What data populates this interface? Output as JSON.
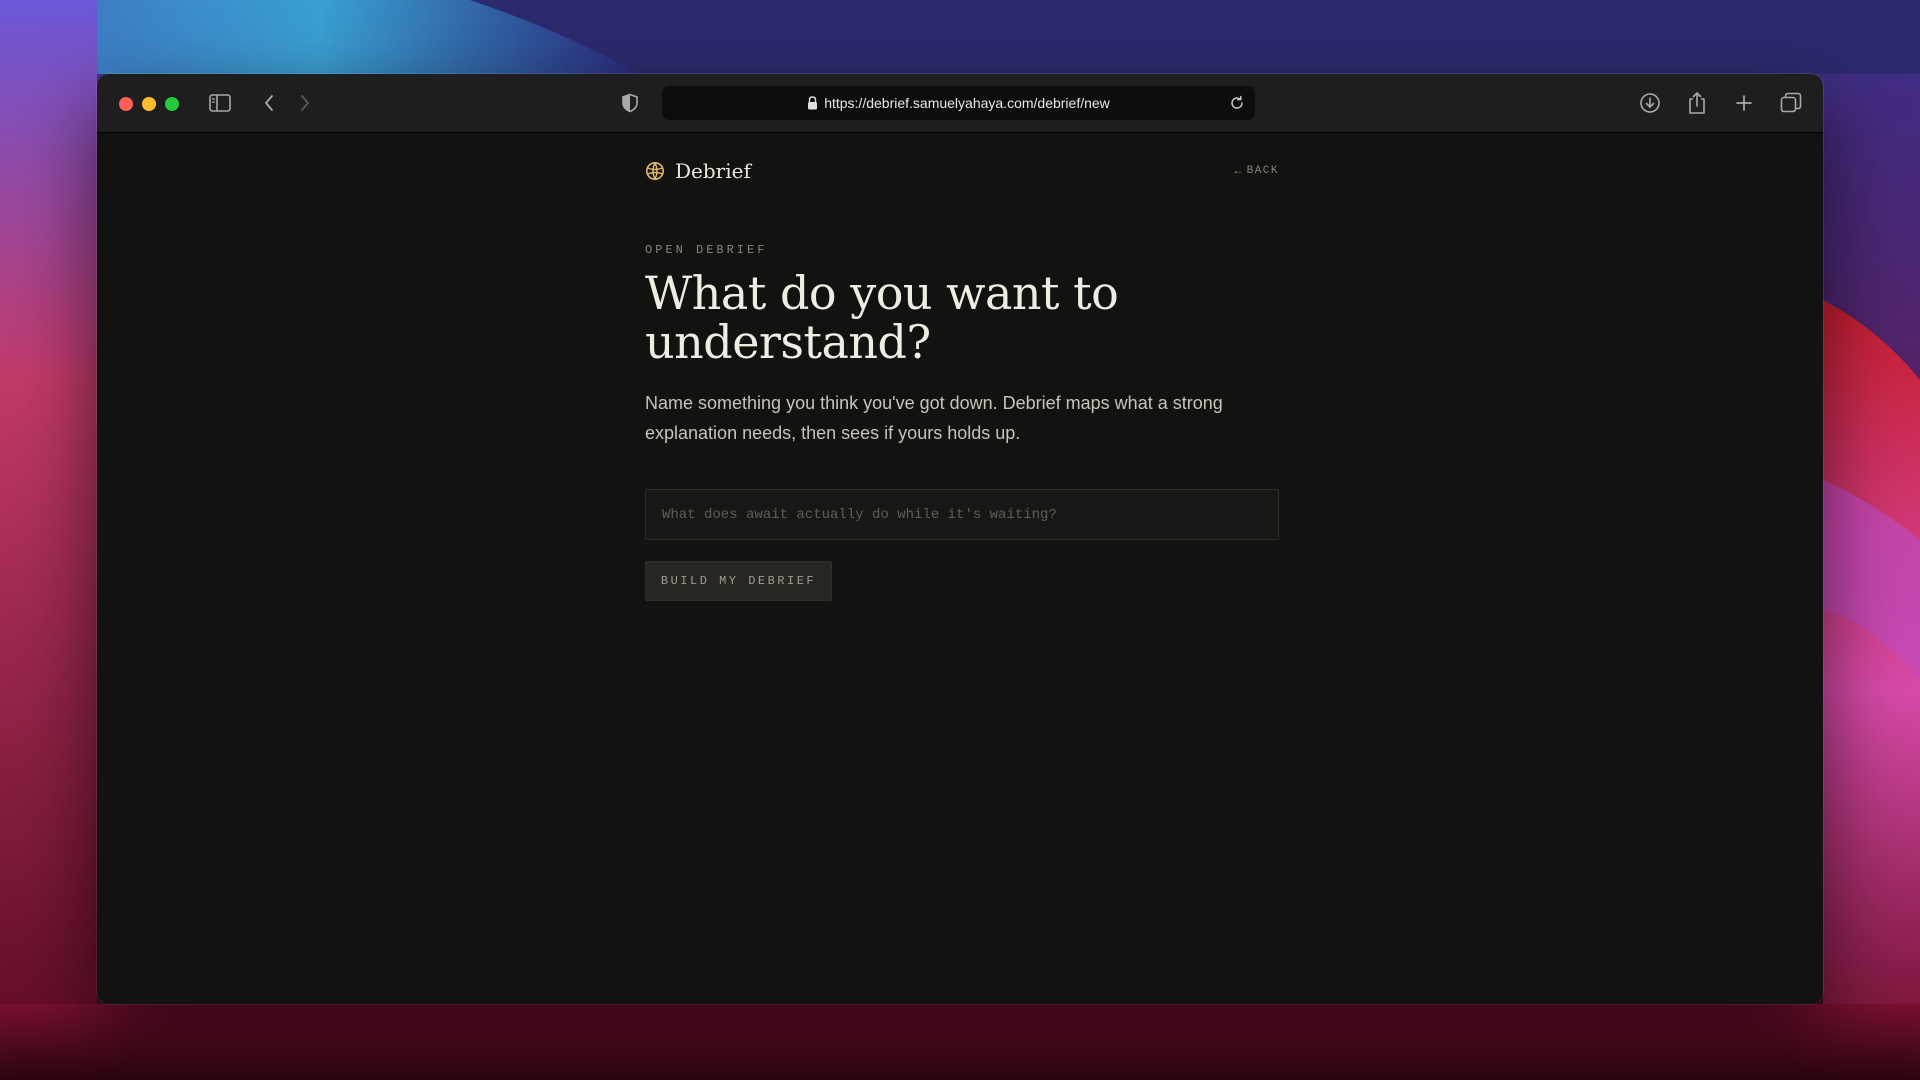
{
  "browser": {
    "url": "https://debrief.samuelyahaya.com/debrief/new",
    "icons": [
      "sidebar-icon",
      "back-chevron-icon",
      "forward-chevron-icon",
      "shield-icon",
      "lock-icon",
      "reload-icon",
      "download-icon",
      "share-icon",
      "new-tab-icon",
      "tab-overview-icon"
    ]
  },
  "app": {
    "brand_name": "Debrief",
    "back_label": "BACK"
  },
  "main": {
    "eyebrow": "OPEN DEBRIEF",
    "headline": "What do you want to understand?",
    "lede": "Name something you think you've got down. Debrief maps what a strong explanation needs, then sees if yours holds up.",
    "input": {
      "value": "",
      "placeholder": "What does await actually do while it's waiting?"
    },
    "submit_label": "BUILD MY DEBRIEF"
  },
  "colors": {
    "page_background": "#121211",
    "heading": "#f1ece2",
    "muted": "#8a857c",
    "accent": "#e0b96a"
  }
}
